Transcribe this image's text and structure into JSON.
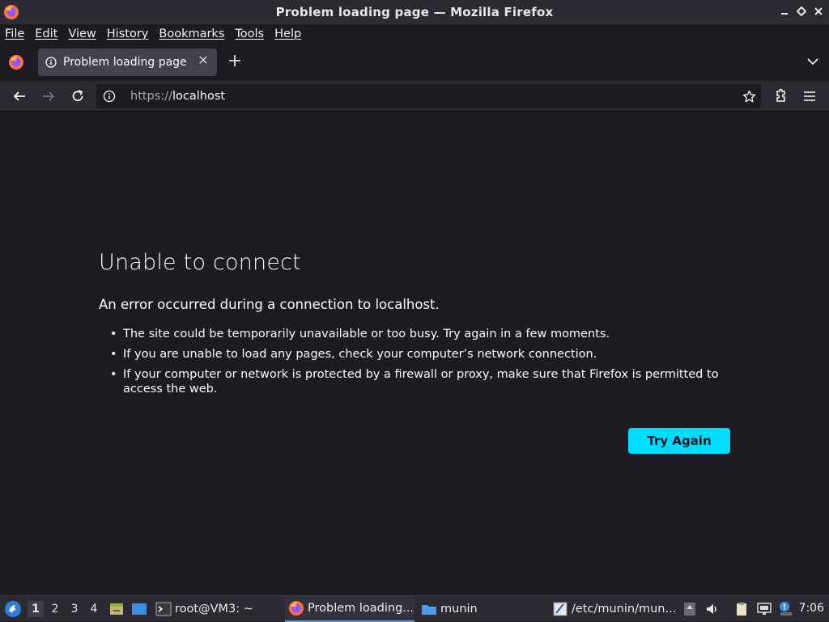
{
  "window": {
    "title": "Problem loading page — Mozilla Firefox",
    "controls": {
      "minimize": "_",
      "restore": "◇",
      "close": "✕"
    }
  },
  "menubar": {
    "items": [
      "File",
      "Edit",
      "View",
      "History",
      "Bookmarks",
      "Tools",
      "Help"
    ]
  },
  "tabs": [
    {
      "label": "Problem loading page",
      "active": true
    }
  ],
  "navbar": {
    "url_scheme": "https://",
    "url_host": "localhost"
  },
  "error": {
    "title": "Unable to connect",
    "description": "An error occurred during a connection to localhost.",
    "bullets": [
      "The site could be temporarily unavailable or too busy. Try again in a few moments.",
      "If you are unable to load any pages, check your computer’s network connection.",
      "If your computer or network is protected by a firewall or proxy, make sure that Firefox is permitted to access the web."
    ],
    "button_label": "Try Again"
  },
  "taskbar": {
    "workspaces": [
      "1",
      "2",
      "3",
      "4"
    ],
    "active_workspace": "1",
    "tasks": [
      {
        "label": "root@VM3: ~",
        "icon": "terminal-icon"
      },
      {
        "label": "Problem loading...",
        "icon": "firefox-icon",
        "active": true
      },
      {
        "label": "munin",
        "icon": "folder-icon"
      },
      {
        "label": "/etc/munin/mun...",
        "icon": "text-editor-icon"
      }
    ],
    "clock": "7:06"
  },
  "colors": {
    "accent_button": "#00ddff",
    "background": "#1c1b22",
    "toolbar": "#2b2a33",
    "active_tab": "#42414d"
  }
}
